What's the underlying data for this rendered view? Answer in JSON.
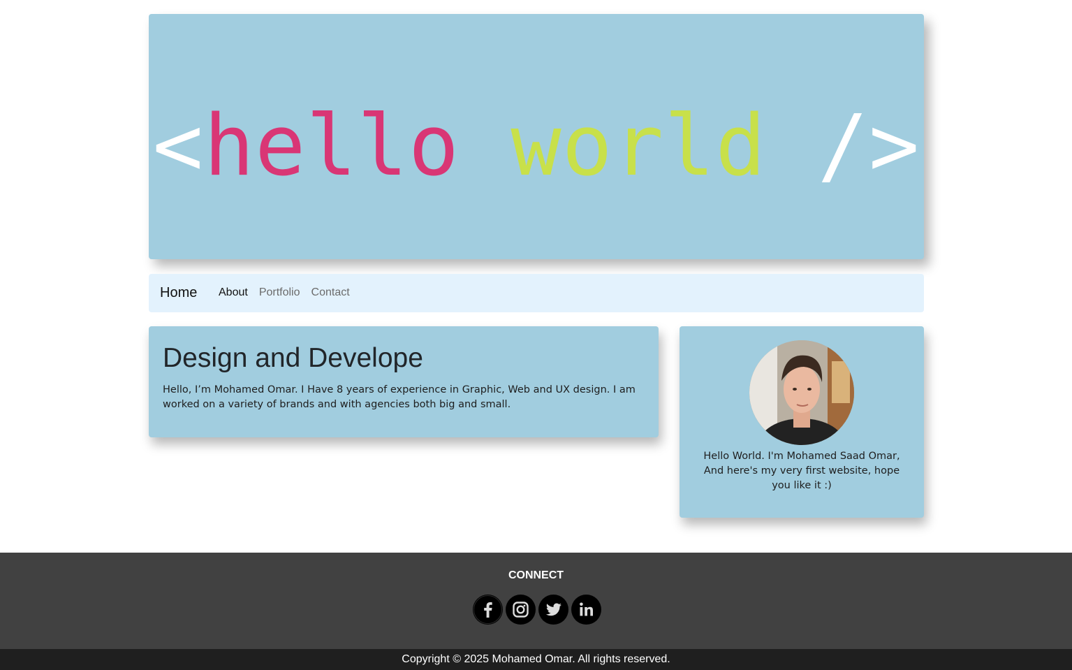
{
  "hero": {
    "open": "<",
    "hello": "hello",
    "world": "world",
    "close": "/>",
    "colors": {
      "background": "#a1cddf",
      "hello": "#d93675",
      "world": "#c8e04a",
      "tags": "#ffffff"
    }
  },
  "nav": {
    "brand": "Home",
    "links": [
      {
        "label": "About",
        "active": true
      },
      {
        "label": "Portfolio",
        "active": false
      },
      {
        "label": "Contact",
        "active": false
      }
    ]
  },
  "main": {
    "title": "Design and Develope",
    "body": "Hello, I’m Mohamed Omar. I Have 8 years of experience in Graphic, Web and UX design. I am worked on a variety of brands and with agencies both big and small."
  },
  "profile": {
    "text": "Hello World. I'm Mohamed Saad Omar, And here's my very first website, hope you like it :)"
  },
  "footer": {
    "heading": "CONNECT",
    "social": [
      {
        "icon": "facebook-icon"
      },
      {
        "icon": "instagram-icon"
      },
      {
        "icon": "twitter-icon"
      },
      {
        "icon": "linkedin-icon"
      }
    ],
    "copyright": "Copyright © 2025 Mohamed Omar. All rights reserved."
  }
}
